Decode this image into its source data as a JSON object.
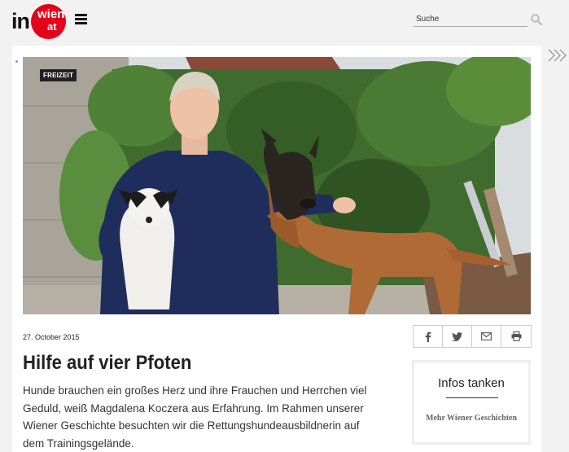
{
  "header": {
    "logo": {
      "in": "in",
      "wien": "wien",
      "at": "at"
    },
    "menu_icon": "hamburger-menu-icon",
    "search": {
      "placeholder": "Suche",
      "icon": "search-icon"
    }
  },
  "article": {
    "category_badge": "FREIZEIT",
    "date": "27. October 2015",
    "title": "Hilfe auf vier Pfoten",
    "lead": "Hunde brauchen ein großes Herz und ihre Frauchen und Herrchen viel Geduld, weiß Magdalena Koczera aus Erfahrung. Im Rahmen unserer Wiener Geschichte besuchten wir die Rettungshundeausbildnerin auf dem Trainingsgelände.",
    "share_icons": [
      "facebook-icon",
      "twitter-icon",
      "mail-icon",
      "print-icon"
    ]
  },
  "sidebox": {
    "heading": "Infos tanken",
    "link": "Mehr Wiener Geschichten"
  },
  "colors": {
    "brand_red": "#e3001b",
    "background": "#f2f2f2",
    "panel": "#ffffff"
  }
}
